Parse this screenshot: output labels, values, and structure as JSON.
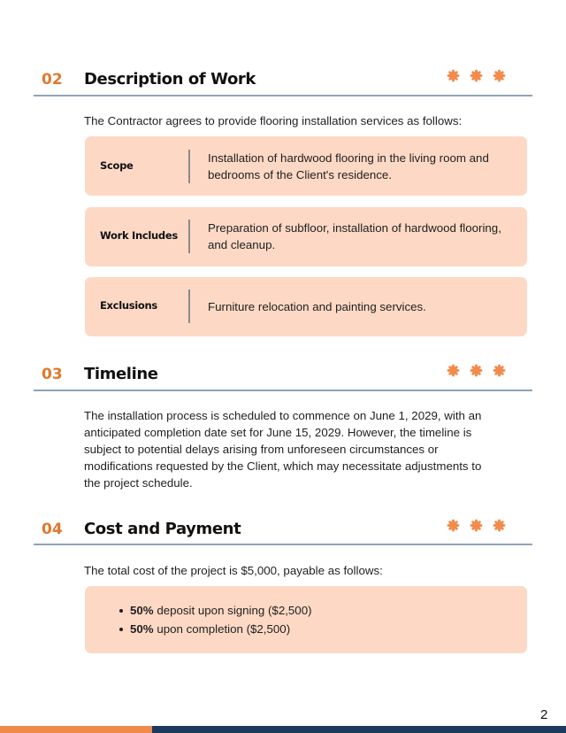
{
  "accent_color": "#e0782f",
  "card_color": "#fdd9c5",
  "sections": [
    {
      "number": "02",
      "title": "Description of Work",
      "decor_icon": "asterisk-flower-icon",
      "lead": "The Contractor agrees to provide flooring installation services as follows:",
      "items": [
        {
          "label": "Scope",
          "text": "Installation of hardwood flooring in the living room and bedrooms of the Client's residence."
        },
        {
          "label": "Work Includes",
          "text": "Preparation of subfloor, installation of hardwood flooring, and cleanup."
        },
        {
          "label": "Exclusions",
          "text": "Furniture relocation and painting services."
        }
      ]
    },
    {
      "number": "03",
      "title": "Timeline",
      "decor_icon": "asterisk-flower-icon",
      "body": "The installation process is scheduled to commence on June 1, 2029, with an anticipated completion date set for June 15, 2029. However, the timeline is subject to potential delays arising from unforeseen circumstances or modifications requested by the Client, which may necessitate adjustments to the project schedule."
    },
    {
      "number": "04",
      "title": "Cost and Payment",
      "decor_icon": "asterisk-flower-icon",
      "lead": "The total cost of the project is $5,000, payable as follows:",
      "payments": [
        {
          "percent": "50%",
          "text": " deposit upon signing ($2,500)"
        },
        {
          "percent": "50%",
          "text": " upon completion ($2,500)"
        }
      ]
    }
  ],
  "footer": {
    "page_number": "2"
  }
}
